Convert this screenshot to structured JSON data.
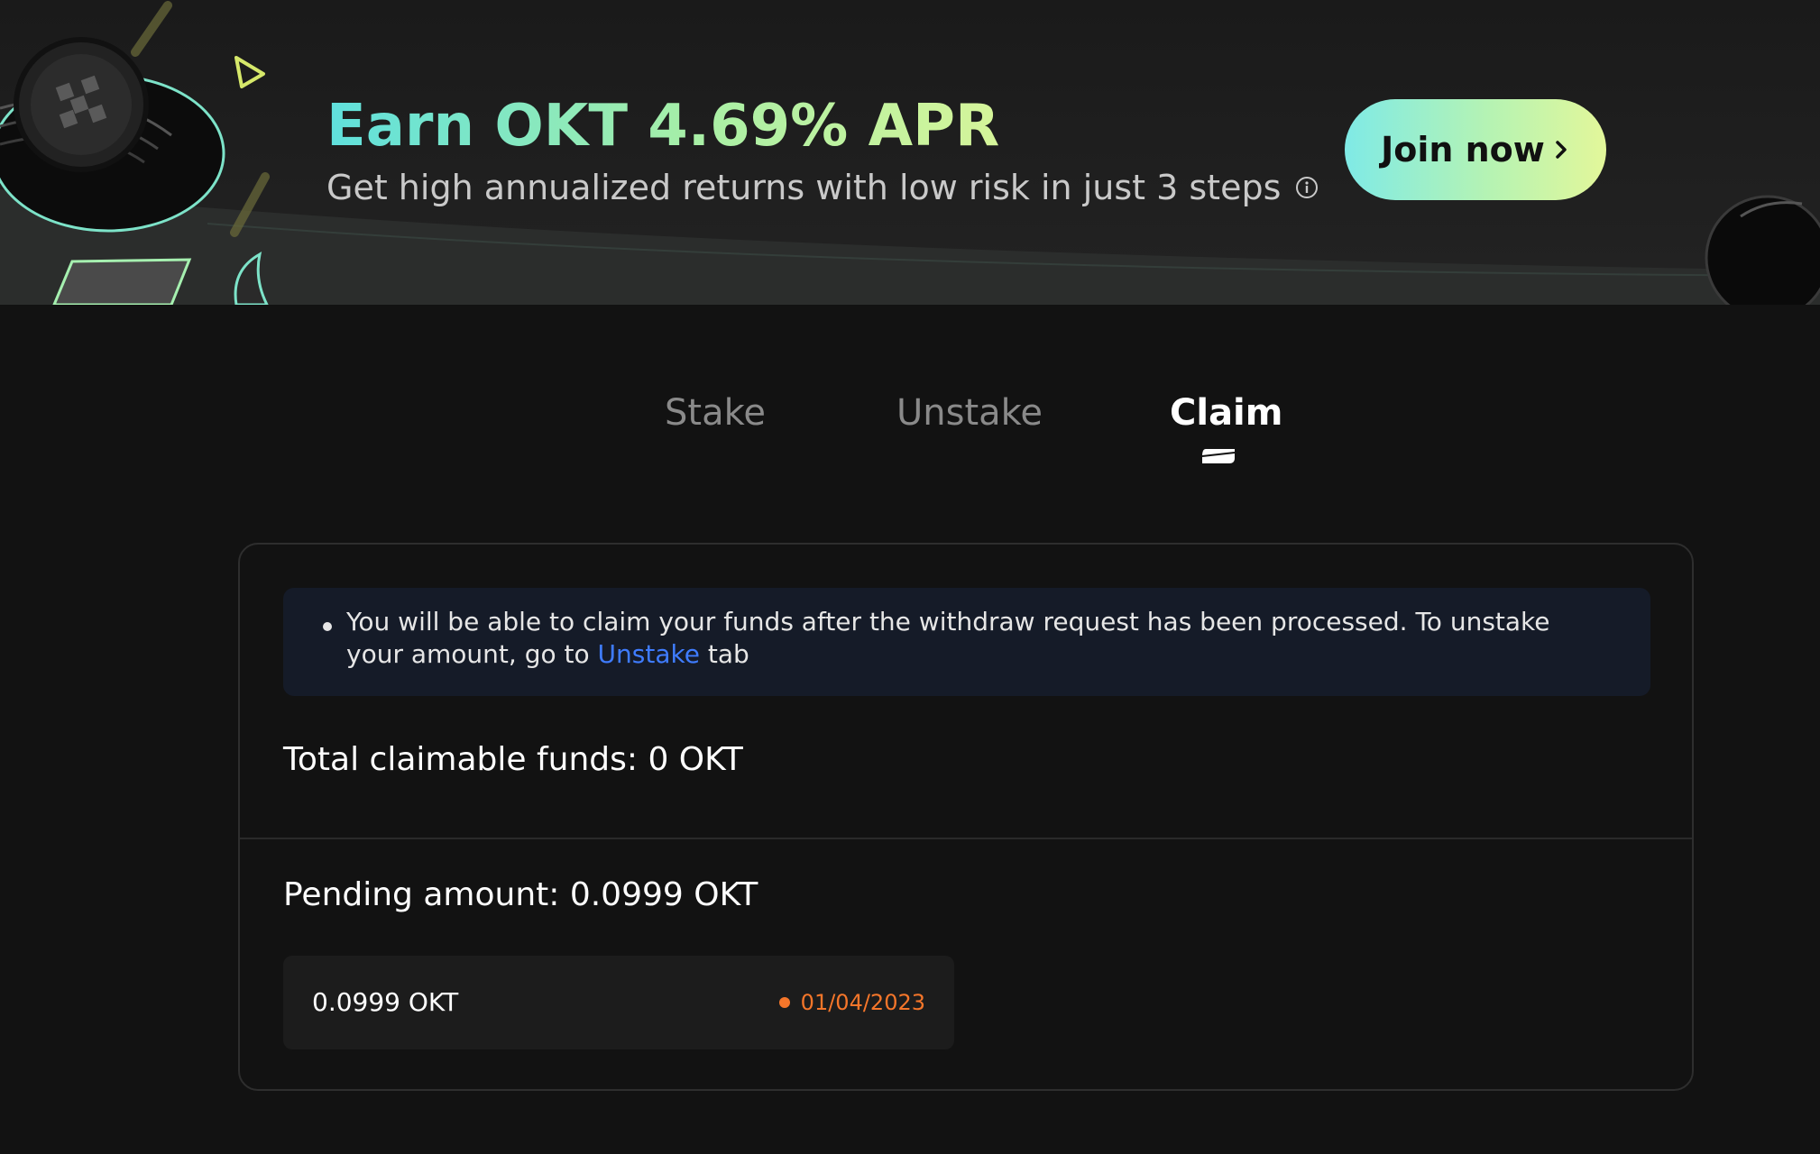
{
  "banner": {
    "title": "Earn OKT 4.69% APR",
    "subtitle": "Get high annualized returns with low risk in just 3 steps",
    "join_label": "Join now",
    "info_icon": "info-icon",
    "chevron_icon": "chevron-right-icon"
  },
  "tabs": [
    {
      "label": "Stake",
      "active": false
    },
    {
      "label": "Unstake",
      "active": false
    },
    {
      "label": "Claim",
      "active": true
    }
  ],
  "notice": {
    "text_before": "You will be able to claim your funds after the withdraw request has been processed. To unstake your amount, go to ",
    "link_label": "Unstake",
    "text_after": " tab"
  },
  "claim": {
    "total_label": "Total claimable funds: 0 OKT",
    "pending_label": "Pending amount: 0.0999 OKT",
    "pending_items": [
      {
        "amount": "0.0999 OKT",
        "date": "01/04/2023"
      }
    ]
  },
  "colors": {
    "accent_start": "#5fe0dd",
    "accent_end": "#d6f59a",
    "link": "#3f7cff",
    "pending_status": "#f5762a",
    "notice_bg": "#151b28"
  }
}
